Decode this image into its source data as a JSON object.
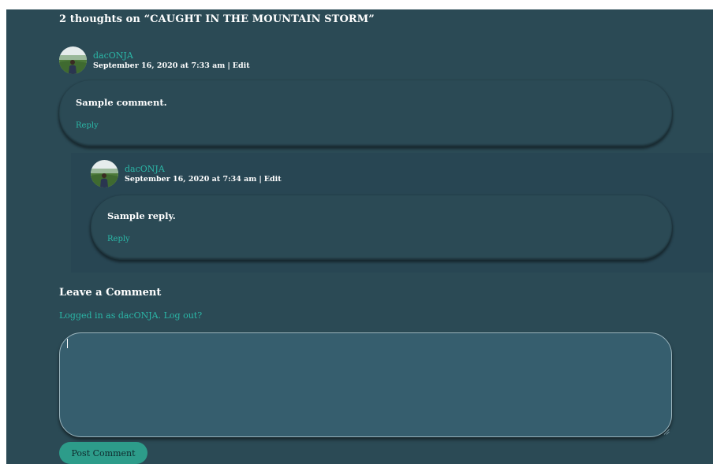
{
  "comments_title": "2 thoughts on “CAUGHT IN THE MOUNTAIN STORM”",
  "comments": [
    {
      "author": "dacONJA",
      "date": "September 16, 2020 at 7:33 am",
      "separator": "|",
      "edit_label": "Edit",
      "text": "Sample comment.",
      "reply_label": "Reply"
    },
    {
      "author": "dacONJA",
      "date": "September 16, 2020 at 7:34 am",
      "separator": "|",
      "edit_label": "Edit",
      "text": "Sample reply.",
      "reply_label": "Reply"
    }
  ],
  "respond": {
    "title": "Leave a Comment",
    "logged_in_prefix": "Logged in as ",
    "logged_in_user": "dacONJA",
    "logged_in_period": ". ",
    "logout_label": "Log out?",
    "comment_value": "",
    "submit_label": "Post Comment"
  },
  "colors": {
    "background": "#2b4a55",
    "accent": "#2bb7a7",
    "button": "#2d9c8a",
    "textarea": "#365e6e"
  },
  "icons": {
    "avatar": "user-avatar-photo",
    "resize": "resize-grip-icon"
  }
}
